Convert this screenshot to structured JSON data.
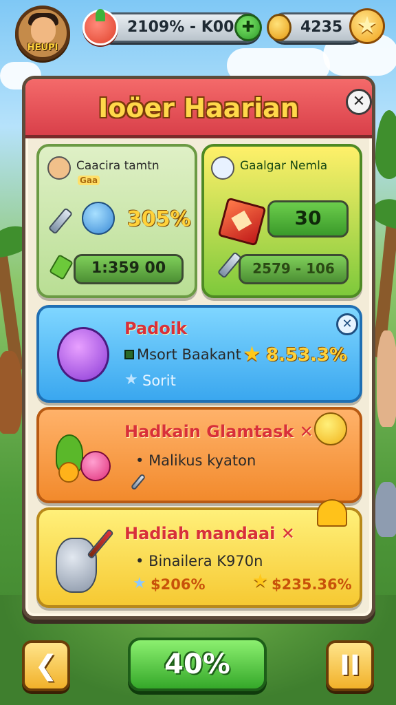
{
  "hud": {
    "player_name": "HEUPI",
    "energy_value": "2109% - K00",
    "coins_value": "4235",
    "energy_plus_icon": "plus-icon",
    "star_icon": "star-icon"
  },
  "panel": {
    "title": "Ioöer Haarian",
    "close_label": "✕"
  },
  "stat_left": {
    "name": "Caacira tamtn",
    "tag": "Gaa",
    "percent": "305%",
    "timer": "1:359 00"
  },
  "stat_right": {
    "name": "Gaalgar Nemla",
    "button_value": "30",
    "range": "2579 - 106"
  },
  "quests": [
    {
      "title": "Padoik",
      "line1": "Msort Baakant",
      "line2": "Sorit",
      "percent": "8.53.3%",
      "close_label": "✕"
    },
    {
      "title": "Hadkain Glamtask ✕",
      "line1": "Malikus kyaton"
    },
    {
      "title": "Hadiah mandaai ✕",
      "line1": "Binailera K970n",
      "reward_left": "$206%",
      "reward_right": "$235.36%"
    }
  ],
  "bottom": {
    "back_label": "❮",
    "main_label": "40%",
    "pause_label": "II"
  },
  "colors": {
    "header_red": "#d9404a",
    "title_gold": "#ffd84a",
    "accent_green": "#35a82a",
    "quest_title_red": "#d8303a"
  }
}
